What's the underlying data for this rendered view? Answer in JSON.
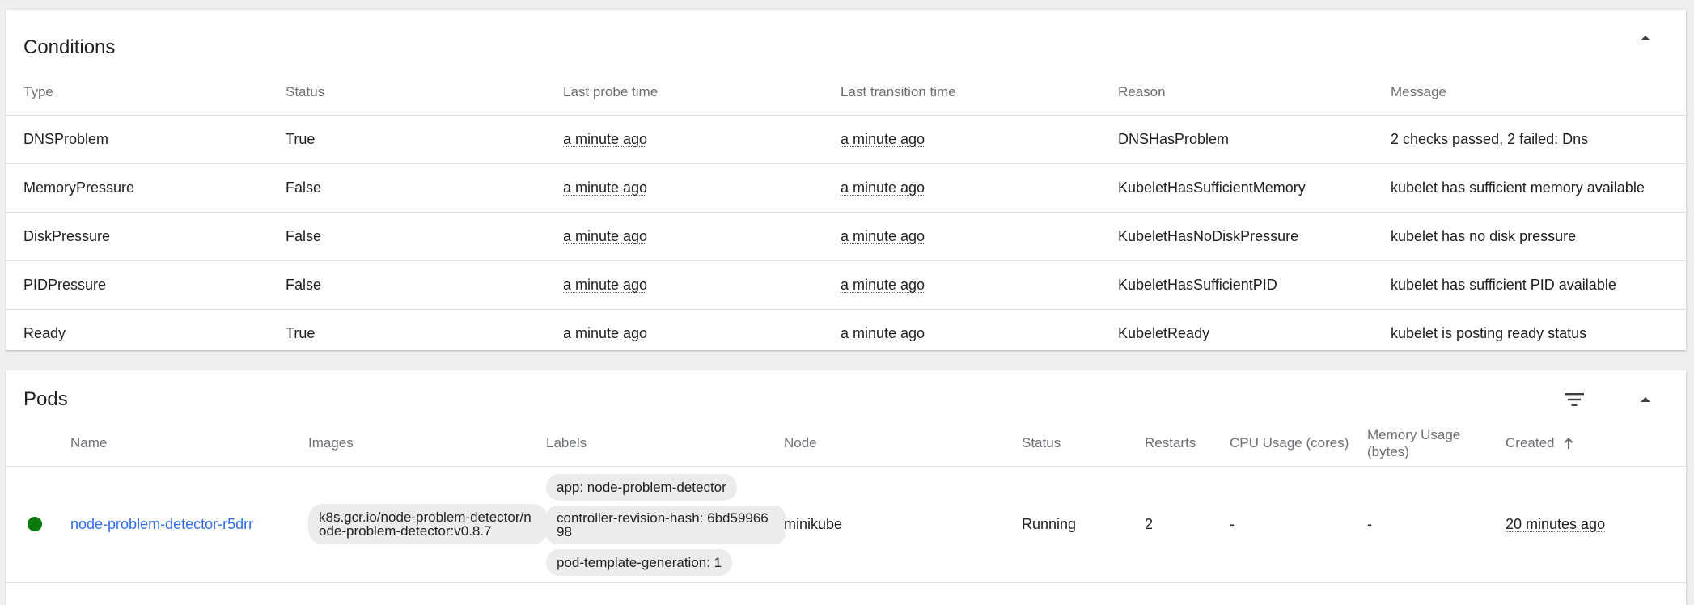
{
  "conditions": {
    "title": "Conditions",
    "columns": [
      "Type",
      "Status",
      "Last probe time",
      "Last transition time",
      "Reason",
      "Message"
    ],
    "rows": [
      {
        "type": "DNSProblem",
        "status": "True",
        "probe": "a minute ago",
        "transition": "a minute ago",
        "reason": "DNSHasProblem",
        "message": "2 checks passed, 2 failed: Dns"
      },
      {
        "type": "MemoryPressure",
        "status": "False",
        "probe": "a minute ago",
        "transition": "a minute ago",
        "reason": "KubeletHasSufficientMemory",
        "message": "kubelet has sufficient memory available"
      },
      {
        "type": "DiskPressure",
        "status": "False",
        "probe": "a minute ago",
        "transition": "a minute ago",
        "reason": "KubeletHasNoDiskPressure",
        "message": "kubelet has no disk pressure"
      },
      {
        "type": "PIDPressure",
        "status": "False",
        "probe": "a minute ago",
        "transition": "a minute ago",
        "reason": "KubeletHasSufficientPID",
        "message": "kubelet has sufficient PID available"
      },
      {
        "type": "Ready",
        "status": "True",
        "probe": "a minute ago",
        "transition": "a minute ago",
        "reason": "KubeletReady",
        "message": "kubelet is posting ready status"
      }
    ]
  },
  "pods": {
    "title": "Pods",
    "columns": {
      "name": "Name",
      "images": "Images",
      "labels": "Labels",
      "node": "Node",
      "status": "Status",
      "restarts": "Restarts",
      "cpu": "CPU Usage (cores)",
      "memory_line1": "Memory Usage",
      "memory_line2": "(bytes)",
      "created": "Created"
    },
    "rows": [
      {
        "name": "node-problem-detector-r5drr",
        "image": "k8s.gcr.io/node-problem-detector/node-problem-detector:v0.8.7",
        "labels": [
          "app: node-problem-detector",
          "controller-revision-hash: 6bd5996698",
          "pod-template-generation: 1"
        ],
        "node": "minikube",
        "status": "Running",
        "restarts": "2",
        "cpu": "-",
        "memory": "-",
        "created": "20 minutes ago"
      }
    ]
  },
  "icons": {
    "collapse": "chevron-up-icon",
    "filter": "filter-icon",
    "sort": "arrow-up-icon",
    "more": "more-vert-icon",
    "status": "status-running-dot"
  },
  "colors": {
    "link": "#326de6",
    "running": "#0b7b10",
    "background": "#eeeff1"
  }
}
